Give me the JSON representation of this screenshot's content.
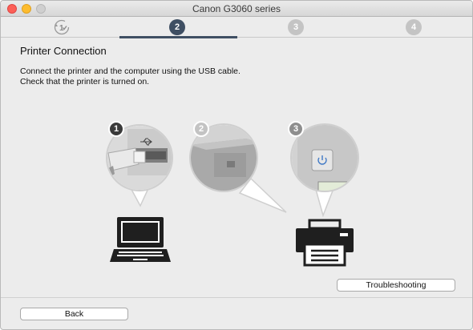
{
  "window": {
    "title": "Canon G3060 series"
  },
  "steps": [
    {
      "number": "1",
      "state": "done"
    },
    {
      "number": "2",
      "state": "active"
    },
    {
      "number": "3",
      "state": "future"
    },
    {
      "number": "4",
      "state": "future"
    }
  ],
  "content": {
    "heading": "Printer Connection",
    "instruction_line1": "Connect the printer and the computer using the USB cable.",
    "instruction_line2": "Check that the printer is turned on.",
    "illustration_steps": [
      "1",
      "2",
      "3"
    ]
  },
  "buttons": {
    "troubleshooting": "Troubleshooting",
    "back": "Back"
  },
  "icons": {
    "usb": "usb-icon",
    "power": "power-icon",
    "laptop": "laptop-icon",
    "printer": "printer-icon"
  },
  "colors": {
    "active_step": "#3f4f63",
    "inactive_step": "#c4c4c4",
    "background": "#ececec"
  }
}
